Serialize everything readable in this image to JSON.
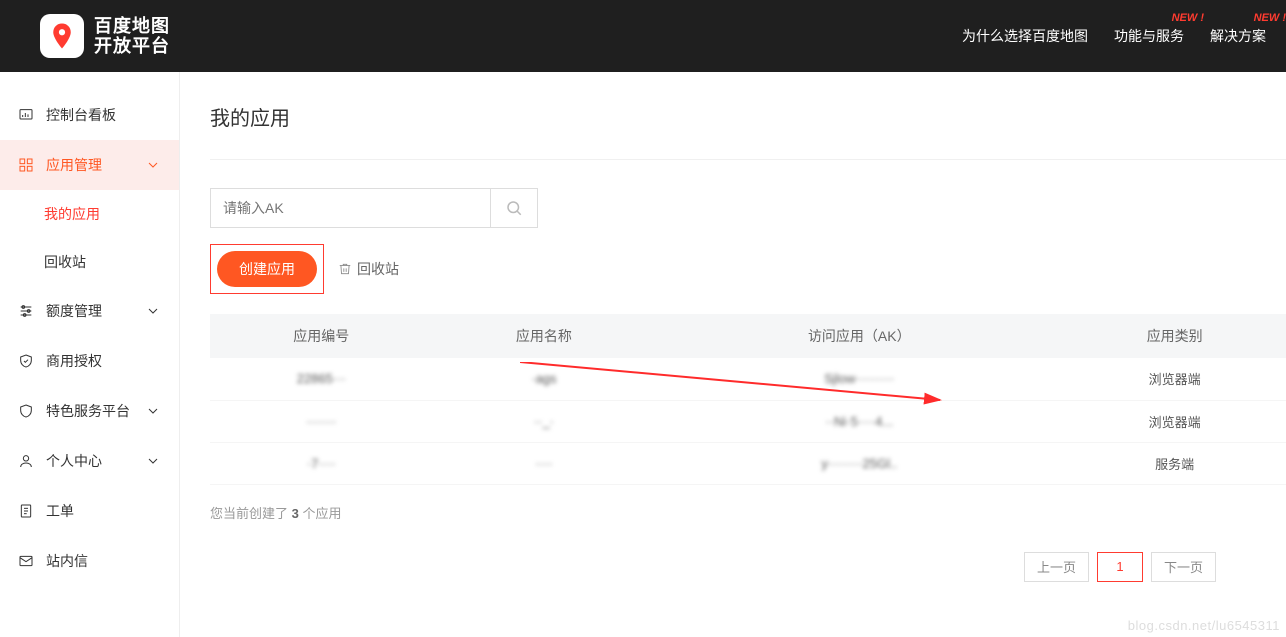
{
  "header": {
    "logo_text1": "百度地图",
    "logo_text2": "开放平台",
    "nav": [
      {
        "label": "为什么选择百度地图",
        "new": false
      },
      {
        "label": "功能与服务",
        "new": true,
        "new_label": "NEW !"
      },
      {
        "label": "解决方案",
        "new": true,
        "new_label": "NEW !"
      }
    ]
  },
  "sidebar": {
    "items": [
      {
        "label": "控制台看板"
      },
      {
        "label": "应用管理",
        "expandable": true,
        "active": true
      },
      {
        "label": "额度管理",
        "expandable": true
      },
      {
        "label": "商用授权"
      },
      {
        "label": "特色服务平台",
        "expandable": true
      },
      {
        "label": "个人中心",
        "expandable": true
      },
      {
        "label": "工单"
      },
      {
        "label": "站内信"
      }
    ],
    "sub": {
      "my_app": "我的应用",
      "recycle": "回收站"
    }
  },
  "main": {
    "title": "我的应用",
    "search_placeholder": "请输入AK",
    "create_btn": "创建应用",
    "recycle_link": "回收站",
    "table": {
      "headers": [
        "应用编号",
        "应用名称",
        "访问应用（AK）",
        "应用类别"
      ],
      "rows": [
        {
          "id": "22865···",
          "name": "·ags",
          "ak": "Sjlow·········",
          "type": "浏览器端"
        },
        {
          "id": "·······",
          "name": "··_·",
          "ak": "··Ni·5····4...",
          "type": "浏览器端"
        },
        {
          "id": "·7····",
          "name": "····",
          "ak": "y········25Gl..",
          "type": "服务端"
        }
      ]
    },
    "summary_pre": "您当前创建了 ",
    "summary_count": "3",
    "summary_post": " 个应用",
    "pager": {
      "prev": "上一页",
      "page": "1",
      "next": "下一页"
    }
  },
  "watermark": "blog.csdn.net/lu6545311"
}
